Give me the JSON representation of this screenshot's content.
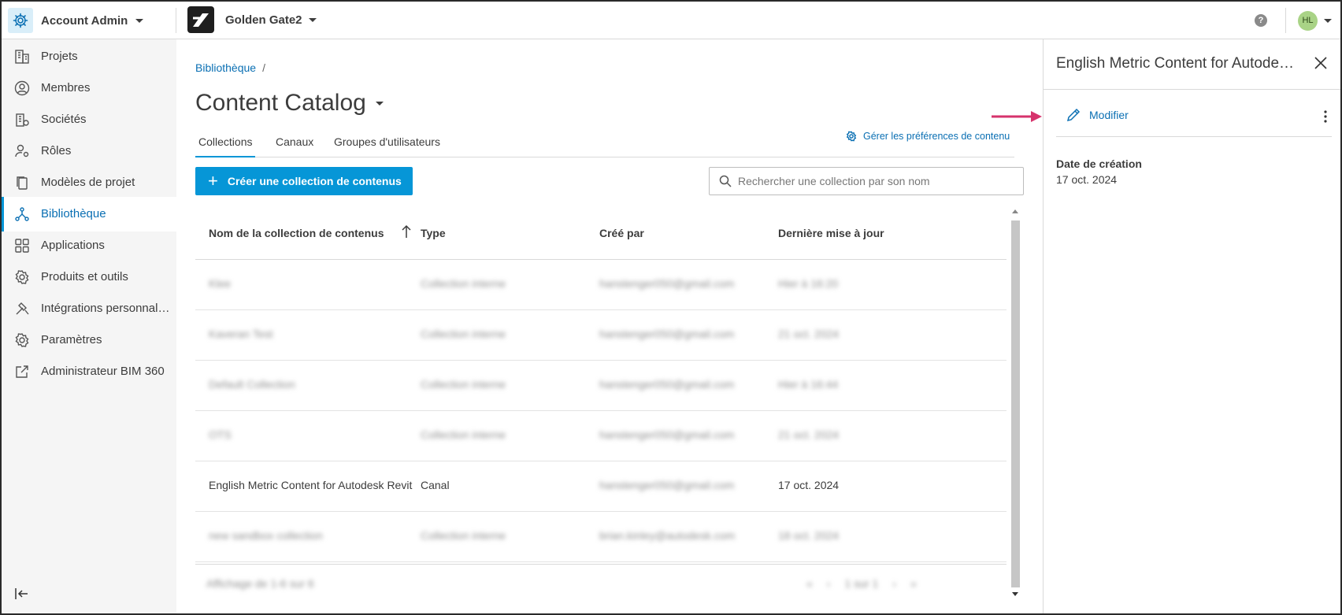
{
  "topbar": {
    "app_title": "Account Admin",
    "project_name": "Golden Gate2",
    "help_icon": "?",
    "user_initials": "HL"
  },
  "sidebar": {
    "items": [
      {
        "label": "Projets",
        "icon": "building-icon"
      },
      {
        "label": "Membres",
        "icon": "user-circle-icon"
      },
      {
        "label": "Sociétés",
        "icon": "company-icon"
      },
      {
        "label": "Rôles",
        "icon": "user-gear-icon"
      },
      {
        "label": "Modèles de projet",
        "icon": "copy-icon"
      },
      {
        "label": "Bibliothèque",
        "icon": "library-icon",
        "active": true
      },
      {
        "label": "Applications",
        "icon": "apps-grid-icon"
      },
      {
        "label": "Produits et outils",
        "icon": "gear-settings-icon"
      },
      {
        "label": "Intégrations personnalisées",
        "icon": "hammer-icon"
      },
      {
        "label": "Paramètres",
        "icon": "gear-icon"
      },
      {
        "label": "Administrateur BIM 360",
        "icon": "external-link-icon"
      }
    ]
  },
  "main": {
    "breadcrumb": "Bibliothèque",
    "breadcrumb_sep": "/",
    "title": "Content Catalog",
    "tabs": [
      "Collections",
      "Canaux",
      "Groupes d'utilisateurs"
    ],
    "prefs_link": "Gérer les préférences de contenu",
    "create_button": "Créer une collection de contenus",
    "search_placeholder": "Rechercher une collection par son nom"
  },
  "table": {
    "columns": [
      "Nom de la collection de contenus",
      "Type",
      "Créé par",
      "Dernière mise à jour"
    ],
    "rows": [
      {
        "name": "Klee",
        "type": "Collection interne",
        "created_by": "hanstenger050@gmail.com",
        "updated": "Hier à 16:20",
        "blurred": true
      },
      {
        "name": "Kaveran Test",
        "type": "Collection interne",
        "created_by": "hanstenger050@gmail.com",
        "updated": "21 oct. 2024",
        "blurred": true
      },
      {
        "name": "Default Collection",
        "type": "Collection interne",
        "created_by": "hanstenger050@gmail.com",
        "updated": "Hier à 16:44",
        "blurred": true
      },
      {
        "name": "OTS",
        "type": "Collection interne",
        "created_by": "hanstenger050@gmail.com",
        "updated": "21 oct. 2024",
        "blurred": true
      },
      {
        "name": "English Metric Content for Autodesk Revit",
        "type": "Canal",
        "created_by": "hanstenger050@gmail.com",
        "updated": "17 oct. 2024",
        "blurred_cols": [
          "created_by"
        ]
      },
      {
        "name": "new sandbox collection",
        "type": "Collection interne",
        "created_by": "brian.kinley@autodesk.com",
        "updated": "18 oct. 2024",
        "blurred": true
      }
    ],
    "footer_text": "Affichage de 1-6 sur 6",
    "pager_text": "1 sur 1"
  },
  "panel": {
    "title": "English Metric Content for Autodesk Revit",
    "edit_label": "Modifier",
    "field_label": "Date de création",
    "field_value": "17 oct. 2024"
  },
  "colors": {
    "accent": "#0696d7",
    "link": "#0a6fb3",
    "annotation_arrow": "#d6336c",
    "avatar_bg": "#a9d386"
  }
}
